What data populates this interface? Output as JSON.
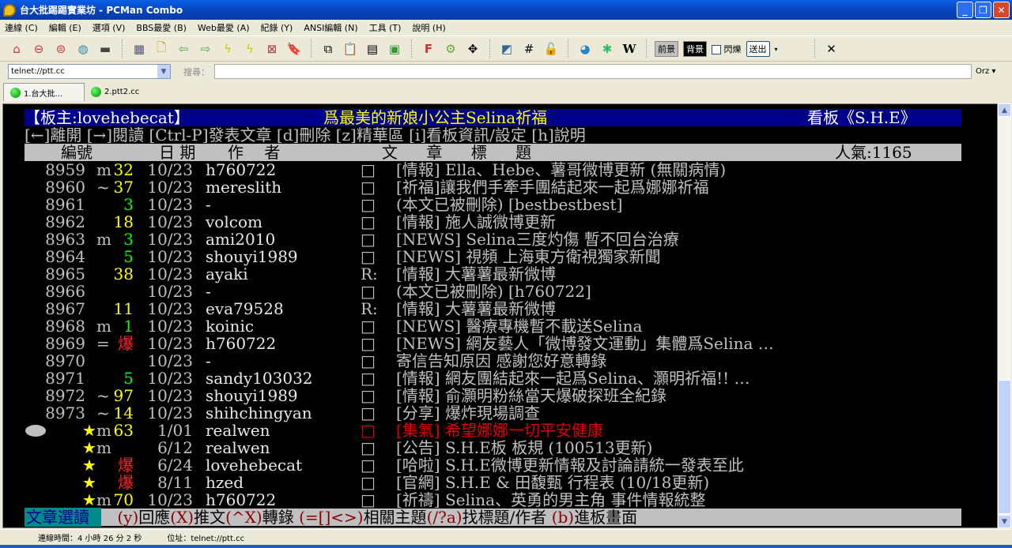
{
  "window": {
    "title": "台大批踢踢實業坊 - PCMan Combo"
  },
  "menu": [
    "連線 (C)",
    "編輯 (E)",
    "選項 (V)",
    "BBS最愛 (B)",
    "Web最愛 (A)",
    "紀錄 (Y)",
    "ANSI編輯 (N)",
    "工具 (T)",
    "說明 (H)"
  ],
  "toolbar": {
    "fg_label": "前景",
    "bg_label": "背景",
    "blink_label": "閃爍",
    "send_label": "送出",
    "close_symbol": "✕"
  },
  "address": {
    "value": "telnet://ptt.cc",
    "search_label": "搜尋：",
    "search_value": "",
    "engine": "Orz"
  },
  "tabs": [
    {
      "label": "1.台大批..."
    },
    {
      "label": "2.ptt2.cc"
    }
  ],
  "terminal": {
    "header_left": "【板主:lovehebecat】",
    "header_mid": "爲最美的新娘小公主Selina祈福",
    "header_right": "看板《S.H.E》",
    "help_line": "[←]離開 [→]閱讀 [Ctrl-P]發表文章 [d]刪除 [z]精華區 [i]看板資訊/設定 [h]說明",
    "col_num": "編號",
    "col_date": "日 期",
    "col_author": "作  者",
    "col_title": "文  章  標  題",
    "popularity": "人氣:1165",
    "rows": [
      {
        "num": "8959",
        "mark": "m",
        "count": "32",
        "count_color": "#ffff00",
        "date": "10/23",
        "author": "h760722",
        "flag": "□",
        "title": "[情報] Ella、Hebe、薯哥微博更新 (無關病情)"
      },
      {
        "num": "8960",
        "mark": "~",
        "count": "37",
        "count_color": "#ffff00",
        "date": "10/23",
        "author": "mereslith",
        "flag": "□",
        "title": "[祈福]讓我們手牽手團結起來一起爲娜娜祈福"
      },
      {
        "num": "8961",
        "mark": "",
        "count": "3",
        "count_color": "#00ff00",
        "date": "10/23",
        "author": "-",
        "flag": "□",
        "title": "(本文已被刪除) [bestbestbest]"
      },
      {
        "num": "8962",
        "mark": "",
        "count": "18",
        "count_color": "#ffff00",
        "date": "10/23",
        "author": "volcom",
        "flag": "□",
        "title": "[情報] 施人誠微博更新"
      },
      {
        "num": "8963",
        "mark": "m",
        "count": "3",
        "count_color": "#00ff00",
        "date": "10/23",
        "author": "ami2010",
        "flag": "□",
        "title": "[NEWS] Selina三度灼傷 暫不回台治療"
      },
      {
        "num": "8964",
        "mark": "",
        "count": "5",
        "count_color": "#00ff00",
        "date": "10/23",
        "author": "shouyi1989",
        "flag": "□",
        "title": "[NEWS] 視頻 上海東方衛視獨家新聞"
      },
      {
        "num": "8965",
        "mark": "",
        "count": "38",
        "count_color": "#ffff00",
        "date": "10/23",
        "author": "ayaki",
        "flag": "R:",
        "title": "[情報] 大薯薯最新微博"
      },
      {
        "num": "8966",
        "mark": "",
        "count": "",
        "count_color": "#ffff00",
        "date": "10/23",
        "author": "-",
        "flag": "□",
        "title": "(本文已被刪除) [h760722]"
      },
      {
        "num": "8967",
        "mark": "",
        "count": "11",
        "count_color": "#ffff00",
        "date": "10/23",
        "author": "eva79528",
        "flag": "R:",
        "title": "[情報] 大薯薯最新微博"
      },
      {
        "num": "8968",
        "mark": "m",
        "count": "1",
        "count_color": "#00ff00",
        "date": "10/23",
        "author": "koinic",
        "flag": "□",
        "title": "[NEWS] 醫療專機暫不載送Selina"
      },
      {
        "num": "8969",
        "mark": "=",
        "count": "爆",
        "count_color": "#ff2020",
        "date": "10/23",
        "author": "h760722",
        "flag": "□",
        "title": "[NEWS] 網友藝人「微博發文運動」集體爲Selina …"
      },
      {
        "num": "8970",
        "mark": "",
        "count": "",
        "count_color": "#ffff00",
        "date": "10/23",
        "author": "-",
        "flag": "□",
        "title": "寄信告知原因  感謝您好意轉錄"
      },
      {
        "num": "8971",
        "mark": "",
        "count": "5",
        "count_color": "#00ff00",
        "date": "10/23",
        "author": "sandy103032",
        "flag": "□",
        "title": "[情報] 網友團結起來一起爲Selina、灝明祈福!! …"
      },
      {
        "num": "8972",
        "mark": "~",
        "count": "97",
        "count_color": "#ffff00",
        "date": "10/23",
        "author": "shouyi1989",
        "flag": "□",
        "title": "[情報] 俞灝明粉絲當天爆破探班全紀錄"
      },
      {
        "num": "8973",
        "mark": "~",
        "count": "14",
        "count_color": "#ffff00",
        "date": "10/23",
        "author": "shihchingyan",
        "flag": "□",
        "title": "[分享] 爆炸現場調查"
      },
      {
        "num": "★",
        "mark": "m",
        "count": "63",
        "count_color": "#ffff00",
        "date": " 1/01",
        "author": "realwen",
        "flag": "□",
        "title": "[集氣] 希望娜娜一切平安健康",
        "highlight": "#e00000",
        "cursor": true
      },
      {
        "num": "★",
        "mark": "m",
        "count": "",
        "count_color": "#ffff00",
        "date": " 6/12",
        "author": "realwen",
        "flag": "□",
        "title": "[公告] S.H.E板 板規 (100513更新)"
      },
      {
        "num": "★",
        "mark": "",
        "count": "爆",
        "count_color": "#ff2020",
        "date": " 6/24",
        "author": "lovehebecat",
        "flag": "□",
        "title": "[哈啦] S.H.E微博更新情報及討論請統一發表至此"
      },
      {
        "num": "★",
        "mark": "",
        "count": "爆",
        "count_color": "#ff2020",
        "date": " 8/11",
        "author": "hzed",
        "flag": "□",
        "title": "[官網] S.H.E & 田馥甄 行程表 (10/18更新)"
      },
      {
        "num": "★",
        "mark": "m",
        "count": "70",
        "count_color": "#ffff00",
        "date": "10/23",
        "author": "h760722",
        "flag": "□",
        "title": "[祈禱] Selina、英勇的男主角 事件情報統整"
      }
    ],
    "footer_mode": "文章選讀",
    "footer_keys": [
      {
        "k": "(y)",
        "t": "回應"
      },
      {
        "k": "(X)",
        "t": "推文"
      },
      {
        "k": "(^X)",
        "t": "轉錄 "
      },
      {
        "k": "(=[]<>)",
        "t": "相關主題"
      },
      {
        "k": "(/?a)",
        "t": "找標題/作者 "
      },
      {
        "k": "(b)",
        "t": "進板畫面"
      }
    ]
  },
  "status": {
    "conn_time": "連線時間：4 小時 26 分 2 秒",
    "address": "位址：telnet://ptt.cc"
  }
}
